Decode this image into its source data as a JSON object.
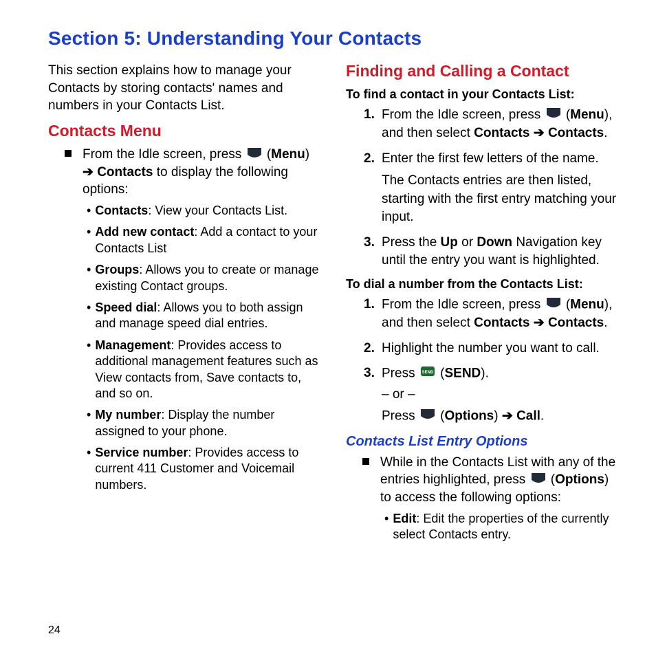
{
  "page_number": "24",
  "section_title": "Section 5: Understanding Your Contacts",
  "intro": "This section explains how to manage your Contacts by storing contacts' names and numbers in your Contacts List.",
  "arrow": "➔",
  "left": {
    "heading": "Contacts Menu",
    "lead_pre": "From the Idle screen, press ",
    "lead_key": "Menu",
    "lead_post_pre": " ",
    "lead_bold": "Contacts",
    "lead_post": " to display the following options:",
    "items": [
      {
        "term": "Contacts",
        "desc": ": View your Contacts List."
      },
      {
        "term": "Add new contact",
        "desc": ": Add a contact to your Contacts List"
      },
      {
        "term": "Groups",
        "desc": ": Allows you to create or manage existing Contact groups."
      },
      {
        "term": "Speed dial",
        "desc": ": Allows you to both assign and manage speed dial entries."
      },
      {
        "term": "Management",
        "desc": ": Provides access to additional management features such as View contacts from, Save contacts to, and so on."
      },
      {
        "term": "My number",
        "desc": ": Display the number assigned to your phone."
      },
      {
        "term": "Service number",
        "desc": ": Provides access to current 411 Customer and Voicemail numbers."
      }
    ]
  },
  "right": {
    "heading": "Finding and Calling a Contact",
    "find_title": "To find a contact in your Contacts List:",
    "find_steps": {
      "s1_pre": "From the Idle screen, press ",
      "s1_key": "Menu",
      "s1_mid": ", and then select ",
      "s1_b1": "Contacts",
      "s1_b2": "Contacts",
      "s1_end": ".",
      "s2a": "Enter the first few letters of the name.",
      "s2b": "The Contacts entries are then listed, starting with the first entry matching your input.",
      "s3_pre": "Press the ",
      "s3_up": "Up",
      "s3_or": " or ",
      "s3_down": "Down",
      "s3_post": " Navigation key until the entry you want is highlighted."
    },
    "dial_title": "To dial a number from the Contacts List:",
    "dial_steps": {
      "s1_pre": "From the Idle screen, press ",
      "s1_key": "Menu",
      "s1_mid": ", and then select ",
      "s1_b1": "Contacts",
      "s1_b2": "Contacts",
      "s1_end": ".",
      "s2": "Highlight the number you want to call.",
      "s3_pre": "Press ",
      "s3_key": "SEND",
      "s3_end": ".",
      "or": "– or –",
      "s3b_pre": "Press ",
      "s3b_key": "Options",
      "s3b_call": "Call",
      "s3b_end": "."
    },
    "entry_heading": "Contacts List Entry Options",
    "entry_lead_pre": "While in the Contacts List with any of the entries highlighted, press ",
    "entry_key": "Options",
    "entry_lead_post": " to access the following options:",
    "entry_items": [
      {
        "term": "Edit",
        "desc": ": Edit the properties of the currently select Contacts entry."
      }
    ]
  }
}
